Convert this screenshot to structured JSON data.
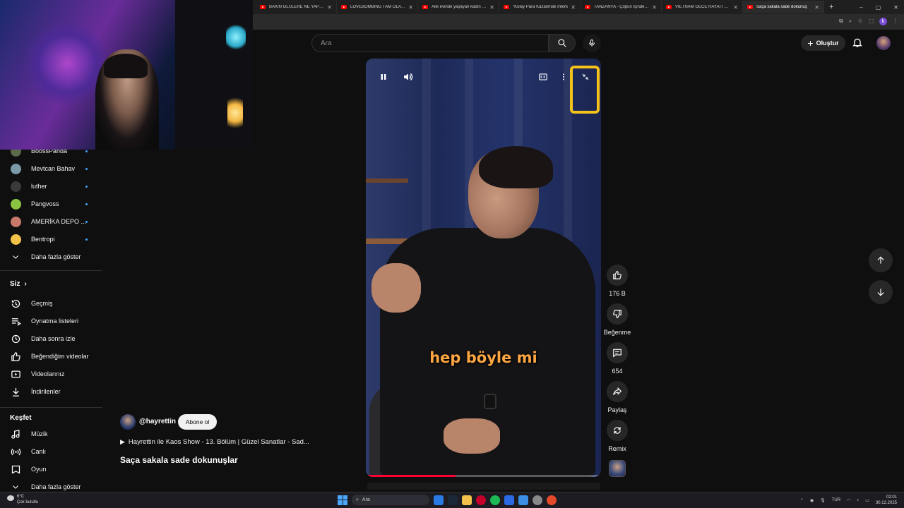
{
  "browser": {
    "tabs": [
      {
        "title": "BAKIN ÖLÜLERE NE YAPIYOR",
        "active": false
      },
      {
        "title": "LOVEBOMBING TAM OLARAK",
        "active": false
      },
      {
        "title": "Aile evinde yaşayan kadın olm",
        "active": false
      },
      {
        "title": "\"Kolay Para Kazanmak İnterk",
        "active": false
      },
      {
        "title": "TANZANYA - Çöpün İçinde Sİ",
        "active": false
      },
      {
        "title": "VIETNAM GECE HAYATI BENİ",
        "active": false
      },
      {
        "title": "Saça sakala sade dokunuş",
        "active": true
      }
    ],
    "new_tab": "+",
    "window_controls": [
      "–",
      "▢",
      "✕"
    ],
    "profile_letter": "k"
  },
  "header": {
    "search_placeholder": "Ara",
    "create_label": "Oluştur"
  },
  "sidebar": {
    "subscriptions": [
      {
        "name": "BoossPanda",
        "color": "#5a6a4a"
      },
      {
        "name": "Mevtcan Bahav",
        "color": "#7a9aa8"
      },
      {
        "name": "luther",
        "color": "#3a3a3a"
      },
      {
        "name": "Pangvoss",
        "color": "#8ac440"
      },
      {
        "name": "AMERİKA DEPO ...",
        "color": "#c87a6a"
      },
      {
        "name": "Bentropi",
        "color": "#f3c24a"
      }
    ],
    "show_more_1": "Daha fazla göster",
    "you_heading": "Siz",
    "you_items": [
      {
        "label": "Geçmiş",
        "icon": "history-icon"
      },
      {
        "label": "Oynatma listeleri",
        "icon": "playlist-icon"
      },
      {
        "label": "Daha sonra izle",
        "icon": "clock-icon"
      },
      {
        "label": "Beğendiğim videolar",
        "icon": "like-icon"
      },
      {
        "label": "Videolarınız",
        "icon": "video-icon"
      },
      {
        "label": "İndirilenler",
        "icon": "download-icon"
      }
    ],
    "explore_heading": "Keşfet",
    "explore_items": [
      {
        "label": "Müzik",
        "icon": "music-icon"
      },
      {
        "label": "Canlı",
        "icon": "live-icon"
      },
      {
        "label": "Oyun",
        "icon": "gaming-icon"
      }
    ],
    "show_more_2": "Daha fazla göster"
  },
  "video": {
    "subtitle": "hep böyle mi",
    "progress": 0.38,
    "channel": "@hayrettin",
    "subscribe_label": "Abone ol",
    "playlist": "Hayrettin ile Kaos Show - 13. Bölüm | Güzel Sanatlar - Sad...",
    "title": "Saça sakala sade dokunuşlar"
  },
  "actions": {
    "like_count": "176 B",
    "dislike_label": "Beğenme",
    "comment_count": "654",
    "share_label": "Paylaş",
    "remix_label": "Remix"
  },
  "taskbar": {
    "weather_temp": "6°C",
    "weather_desc": "Çok bulutlu",
    "search_label": "Ara",
    "language": "TUR",
    "time": "02:01",
    "date": "30.12.2025"
  },
  "colors": {
    "accent_red": "#ff0033",
    "subtitle_orange": "#ffa742",
    "dot_blue": "#3ea6ff"
  }
}
